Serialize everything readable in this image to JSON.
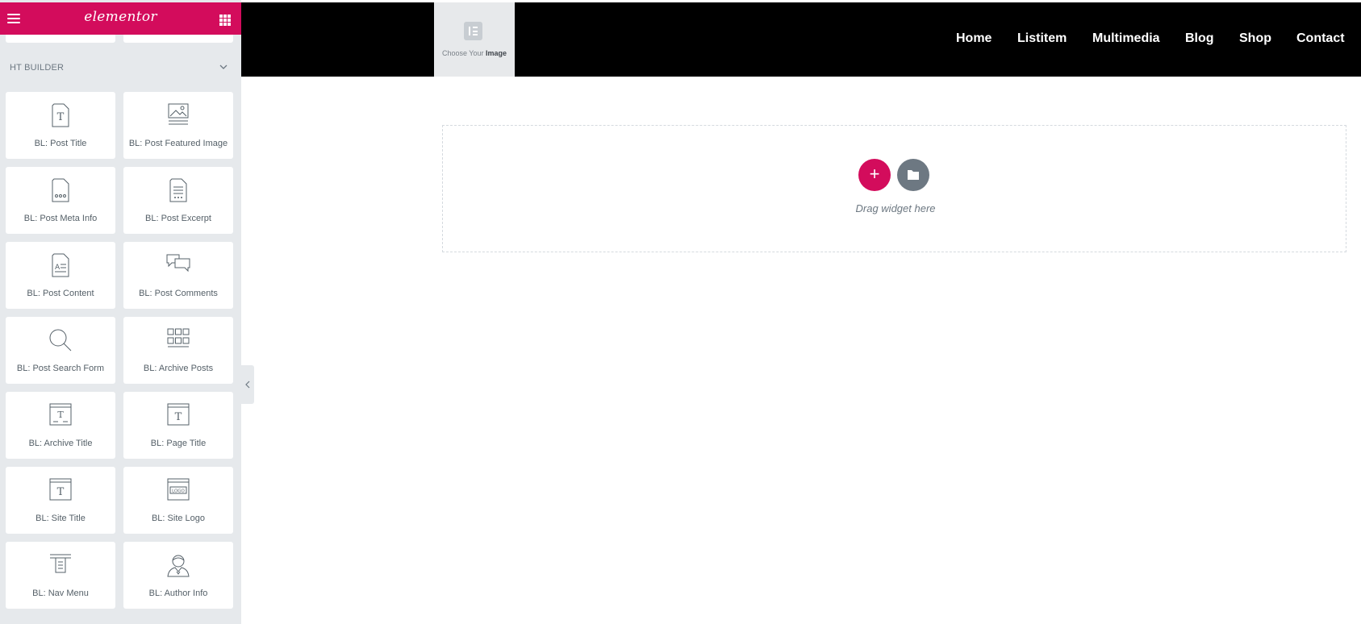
{
  "sidebar": {
    "brand": "elementor",
    "section_title": "HT BUILDER",
    "widgets": [
      {
        "label": "BL: Post Title",
        "icon": "post-title-icon"
      },
      {
        "label": "BL: Post Featured Image",
        "icon": "featured-image-icon"
      },
      {
        "label": "BL: Post Meta Info",
        "icon": "post-meta-icon"
      },
      {
        "label": "BL: Post Excerpt",
        "icon": "post-excerpt-icon"
      },
      {
        "label": "BL: Post Content",
        "icon": "post-content-icon"
      },
      {
        "label": "BL: Post Comments",
        "icon": "comments-icon"
      },
      {
        "label": "BL: Post Search Form",
        "icon": "search-icon"
      },
      {
        "label": "BL: Archive Posts",
        "icon": "archive-posts-icon"
      },
      {
        "label": "BL: Archive Title",
        "icon": "archive-title-icon"
      },
      {
        "label": "BL: Page Title",
        "icon": "page-title-icon"
      },
      {
        "label": "BL: Site Title",
        "icon": "site-title-icon"
      },
      {
        "label": "BL: Site Logo",
        "icon": "site-logo-icon"
      },
      {
        "label": "BL: Nav Menu",
        "icon": "nav-menu-icon"
      },
      {
        "label": "BL: Author Info",
        "icon": "author-icon"
      }
    ],
    "logo_icon_text": "LOGO"
  },
  "header": {
    "logo_placeholder_prefix": "Choose Your",
    "logo_placeholder_bold": "Image",
    "nav": [
      "Home",
      "Listitem",
      "Multimedia",
      "Blog",
      "Shop",
      "Contact"
    ]
  },
  "canvas": {
    "add_label": "+",
    "drag_text": "Drag widget here"
  },
  "colors": {
    "accent": "#d30c5c",
    "panel": "#e6e9ec",
    "header_bg": "#000000",
    "muted": "#6d7882"
  }
}
